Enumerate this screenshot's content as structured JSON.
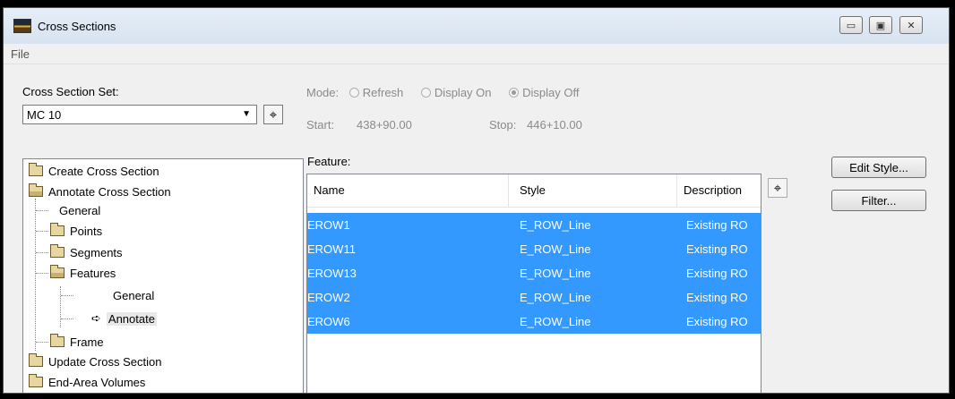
{
  "window": {
    "title": "Cross Sections"
  },
  "menu": {
    "file": "File"
  },
  "cross_section_set": {
    "label": "Cross Section Set:",
    "value": "MC 10"
  },
  "mode": {
    "label": "Mode:",
    "options": [
      "Refresh",
      "Display On",
      "Display Off"
    ],
    "selected": "Display Off"
  },
  "range": {
    "start_label": "Start:",
    "start_value": "438+90.00",
    "stop_label": "Stop:",
    "stop_value": "446+10.00"
  },
  "tree": {
    "create": "Create Cross Section",
    "annotate": "Annotate Cross Section",
    "general": "General",
    "points": "Points",
    "segments": "Segments",
    "features": "Features",
    "features_general": "General",
    "features_annotate": "Annotate",
    "frame": "Frame",
    "update": "Update Cross Section",
    "end_area": "End-Area Volumes"
  },
  "feature": {
    "label": "Feature:",
    "columns": [
      "Name",
      "Style",
      "Description"
    ],
    "rows": [
      {
        "name": "EROW1",
        "style": "E_ROW_Line",
        "description": "Existing RO"
      },
      {
        "name": "EROW11",
        "style": "E_ROW_Line",
        "description": "Existing RO"
      },
      {
        "name": "EROW13",
        "style": "E_ROW_Line",
        "description": "Existing RO"
      },
      {
        "name": "EROW2",
        "style": "E_ROW_Line",
        "description": "Existing RO"
      },
      {
        "name": "EROW6",
        "style": "E_ROW_Line",
        "description": "Existing RO"
      }
    ]
  },
  "buttons": {
    "edit_style": "Edit Style...",
    "filter": "Filter..."
  },
  "icons": {
    "target": "crosshair-target-icon"
  },
  "colors": {
    "selection": "#3399ff"
  }
}
